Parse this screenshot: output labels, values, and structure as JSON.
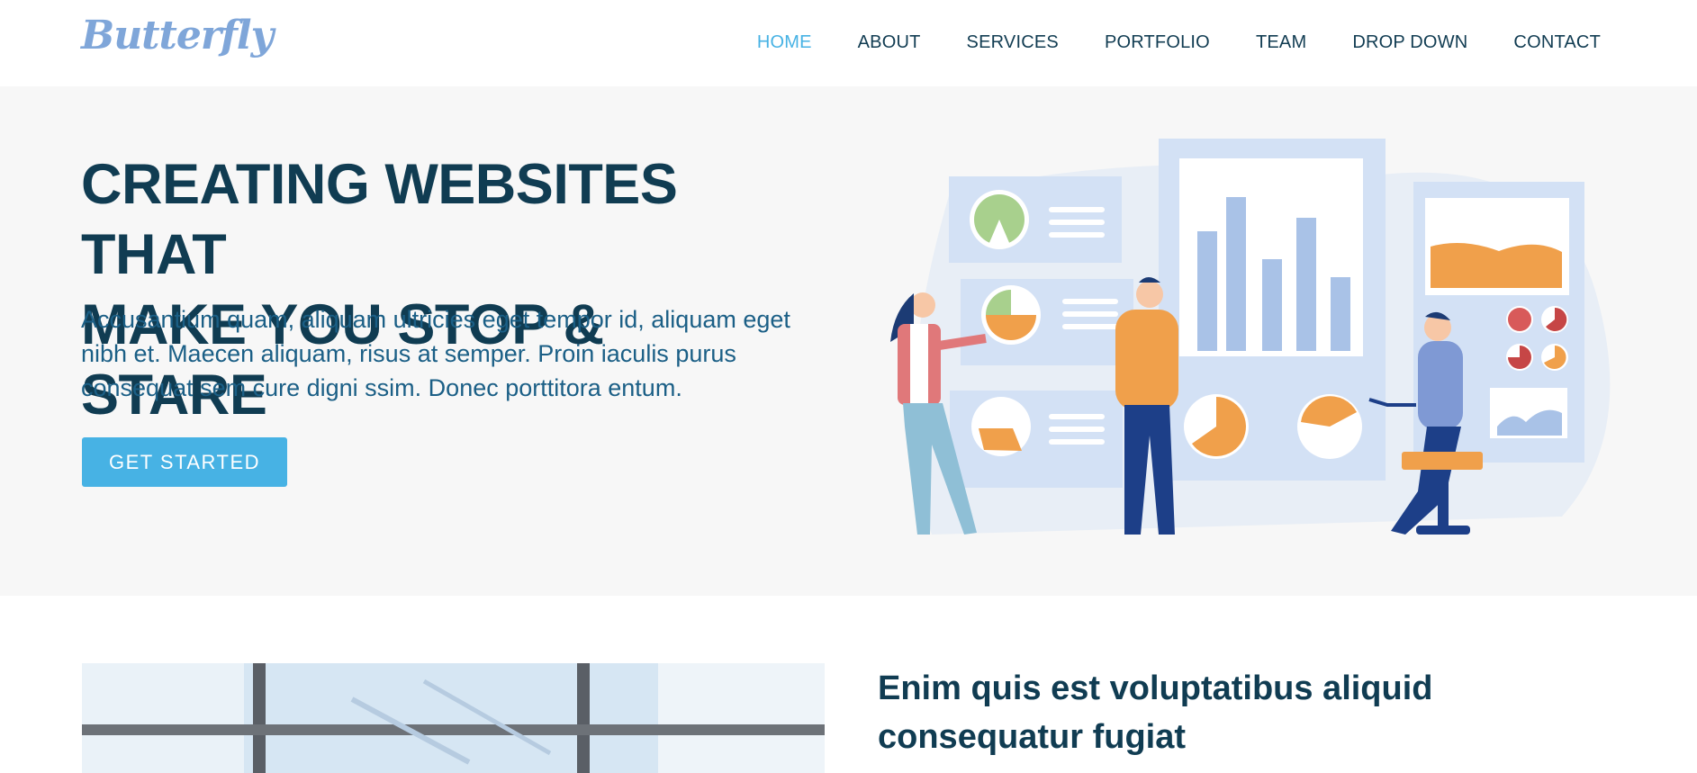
{
  "brand": {
    "logo_text": "Butterfly"
  },
  "nav": {
    "items": [
      {
        "label": "HOME",
        "active": true
      },
      {
        "label": "ABOUT",
        "active": false
      },
      {
        "label": "SERVICES",
        "active": false
      },
      {
        "label": "PORTFOLIO",
        "active": false
      },
      {
        "label": "TEAM",
        "active": false
      },
      {
        "label": "DROP DOWN",
        "active": false
      },
      {
        "label": "CONTACT",
        "active": false
      }
    ]
  },
  "hero": {
    "title_line1": "CREATING WEBSITES THAT",
    "title_line2": "MAKE YOU STOP & STARE",
    "text": "Accusantium quam, aliquam ultricies eget tempor id, aliquam eget nibh et. Maecen aliquam, risus at semper. Proin iaculis purus consequat sem cure digni ssim. Donec porttitora entum.",
    "button_label": "GET STARTED"
  },
  "about": {
    "title": "Enim quis est voluptatibus aliquid consequatur fugiat"
  },
  "colors": {
    "accent": "#47b2e4",
    "heading": "#103c52",
    "hero_bg": "#f7f7f7",
    "illustration_orange": "#f0a04b",
    "illustration_blue": "#a9c2e7"
  }
}
